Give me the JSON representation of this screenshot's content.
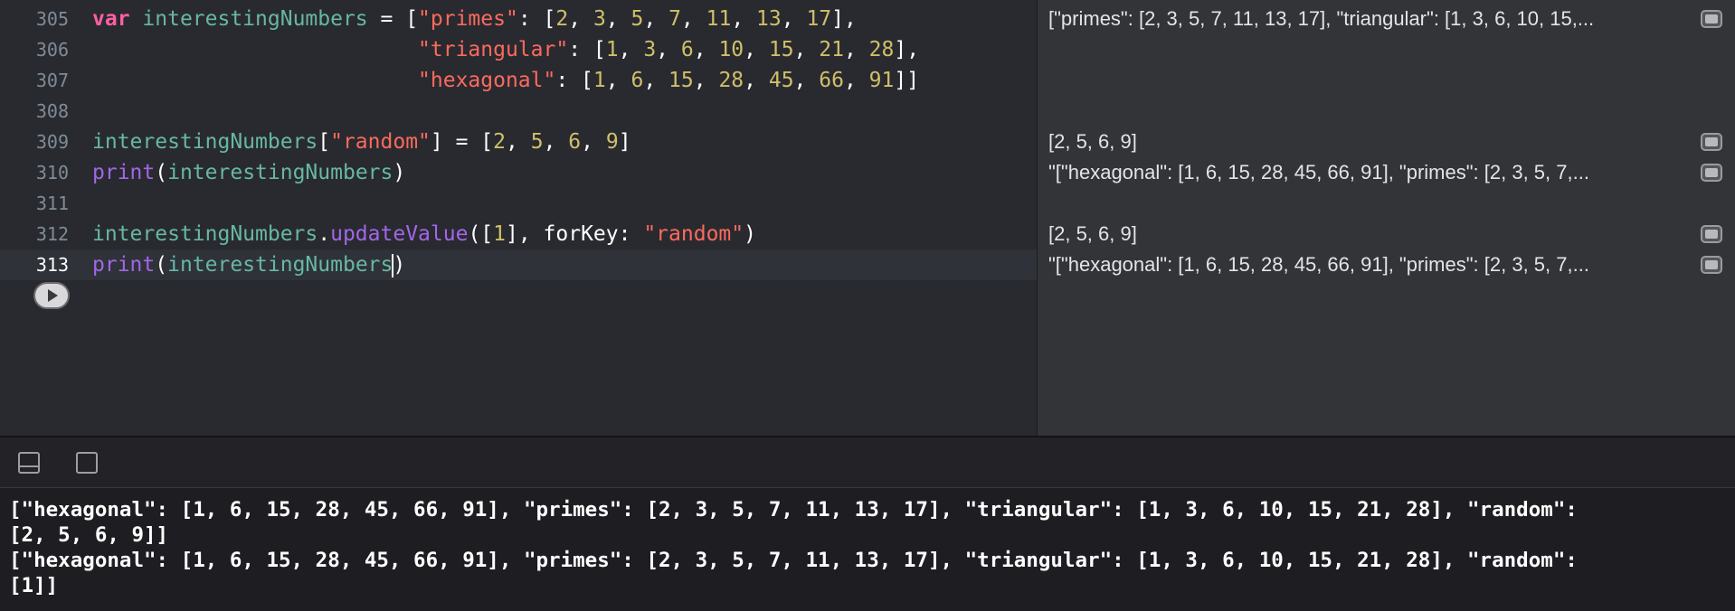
{
  "editor": {
    "lines": [
      {
        "number": "305",
        "tokens": [
          {
            "t": "kw",
            "v": "var"
          },
          {
            "t": "plain",
            "v": " "
          },
          {
            "t": "id",
            "v": "interestingNumbers"
          },
          {
            "t": "plain",
            "v": " = ["
          },
          {
            "t": "str",
            "v": "\"primes\""
          },
          {
            "t": "plain",
            "v": ": ["
          },
          {
            "t": "num",
            "v": "2"
          },
          {
            "t": "plain",
            "v": ", "
          },
          {
            "t": "num",
            "v": "3"
          },
          {
            "t": "plain",
            "v": ", "
          },
          {
            "t": "num",
            "v": "5"
          },
          {
            "t": "plain",
            "v": ", "
          },
          {
            "t": "num",
            "v": "7"
          },
          {
            "t": "plain",
            "v": ", "
          },
          {
            "t": "num",
            "v": "11"
          },
          {
            "t": "plain",
            "v": ", "
          },
          {
            "t": "num",
            "v": "13"
          },
          {
            "t": "plain",
            "v": ", "
          },
          {
            "t": "num",
            "v": "17"
          },
          {
            "t": "plain",
            "v": "],"
          }
        ]
      },
      {
        "number": "306",
        "tokens": [
          {
            "t": "plain",
            "v": "                          "
          },
          {
            "t": "str",
            "v": "\"triangular\""
          },
          {
            "t": "plain",
            "v": ": ["
          },
          {
            "t": "num",
            "v": "1"
          },
          {
            "t": "plain",
            "v": ", "
          },
          {
            "t": "num",
            "v": "3"
          },
          {
            "t": "plain",
            "v": ", "
          },
          {
            "t": "num",
            "v": "6"
          },
          {
            "t": "plain",
            "v": ", "
          },
          {
            "t": "num",
            "v": "10"
          },
          {
            "t": "plain",
            "v": ", "
          },
          {
            "t": "num",
            "v": "15"
          },
          {
            "t": "plain",
            "v": ", "
          },
          {
            "t": "num",
            "v": "21"
          },
          {
            "t": "plain",
            "v": ", "
          },
          {
            "t": "num",
            "v": "28"
          },
          {
            "t": "plain",
            "v": "],"
          }
        ]
      },
      {
        "number": "307",
        "tokens": [
          {
            "t": "plain",
            "v": "                          "
          },
          {
            "t": "str",
            "v": "\"hexagonal\""
          },
          {
            "t": "plain",
            "v": ": ["
          },
          {
            "t": "num",
            "v": "1"
          },
          {
            "t": "plain",
            "v": ", "
          },
          {
            "t": "num",
            "v": "6"
          },
          {
            "t": "plain",
            "v": ", "
          },
          {
            "t": "num",
            "v": "15"
          },
          {
            "t": "plain",
            "v": ", "
          },
          {
            "t": "num",
            "v": "28"
          },
          {
            "t": "plain",
            "v": ", "
          },
          {
            "t": "num",
            "v": "45"
          },
          {
            "t": "plain",
            "v": ", "
          },
          {
            "t": "num",
            "v": "66"
          },
          {
            "t": "plain",
            "v": ", "
          },
          {
            "t": "num",
            "v": "91"
          },
          {
            "t": "plain",
            "v": "]]"
          }
        ]
      },
      {
        "number": "308",
        "tokens": []
      },
      {
        "number": "309",
        "tokens": [
          {
            "t": "id",
            "v": "interestingNumbers"
          },
          {
            "t": "plain",
            "v": "["
          },
          {
            "t": "str",
            "v": "\"random\""
          },
          {
            "t": "plain",
            "v": "] = ["
          },
          {
            "t": "num",
            "v": "2"
          },
          {
            "t": "plain",
            "v": ", "
          },
          {
            "t": "num",
            "v": "5"
          },
          {
            "t": "plain",
            "v": ", "
          },
          {
            "t": "num",
            "v": "6"
          },
          {
            "t": "plain",
            "v": ", "
          },
          {
            "t": "num",
            "v": "9"
          },
          {
            "t": "plain",
            "v": "]"
          }
        ]
      },
      {
        "number": "310",
        "tokens": [
          {
            "t": "fn",
            "v": "print"
          },
          {
            "t": "plain",
            "v": "("
          },
          {
            "t": "id",
            "v": "interestingNumbers"
          },
          {
            "t": "plain",
            "v": ")"
          }
        ]
      },
      {
        "number": "311",
        "tokens": []
      },
      {
        "number": "312",
        "tokens": [
          {
            "t": "id",
            "v": "interestingNumbers"
          },
          {
            "t": "plain",
            "v": "."
          },
          {
            "t": "fn",
            "v": "updateValue"
          },
          {
            "t": "plain",
            "v": "(["
          },
          {
            "t": "num",
            "v": "1"
          },
          {
            "t": "plain",
            "v": "], forKey: "
          },
          {
            "t": "str",
            "v": "\"random\""
          },
          {
            "t": "plain",
            "v": ")"
          }
        ]
      },
      {
        "number": "313",
        "current": true,
        "tokens": [
          {
            "t": "fn",
            "v": "print"
          },
          {
            "t": "plain",
            "v": "("
          },
          {
            "t": "id",
            "v": "interestingNumbers"
          },
          {
            "t": "caret",
            "v": ""
          },
          {
            "t": "plain",
            "v": ")"
          }
        ]
      }
    ],
    "run_button_icon": "play-icon"
  },
  "results": [
    {
      "line": 0,
      "text": "[\"primes\": [2, 3, 5, 7, 11, 13, 17], \"triangular\": [1, 3, 6, 10, 15,..."
    },
    {
      "line": 4,
      "text": "[2, 5, 6, 9]"
    },
    {
      "line": 5,
      "text": "\"[\"hexagonal\": [1, 6, 15, 28, 45, 66, 91], \"primes\": [2, 3, 5, 7,..."
    },
    {
      "line": 7,
      "text": "[2, 5, 6, 9]"
    },
    {
      "line": 8,
      "text": "\"[\"hexagonal\": [1, 6, 15, 28, 45, 66, 91], \"primes\": [2, 3, 5, 7,..."
    }
  ],
  "console_toolbar": {
    "icons": [
      "hide-debug-area-icon",
      "show-panel-icon"
    ]
  },
  "console": {
    "output": "[\"hexagonal\": [1, 6, 15, 28, 45, 66, 91], \"primes\": [2, 3, 5, 7, 11, 13, 17], \"triangular\": [1, 3, 6, 10, 15, 21, 28], \"random\":\n[2, 5, 6, 9]]\n[\"hexagonal\": [1, 6, 15, 28, 45, 66, 91], \"primes\": [2, 3, 5, 7, 11, 13, 17], \"triangular\": [1, 3, 6, 10, 15, 21, 28], \"random\":\n[1]]"
  }
}
